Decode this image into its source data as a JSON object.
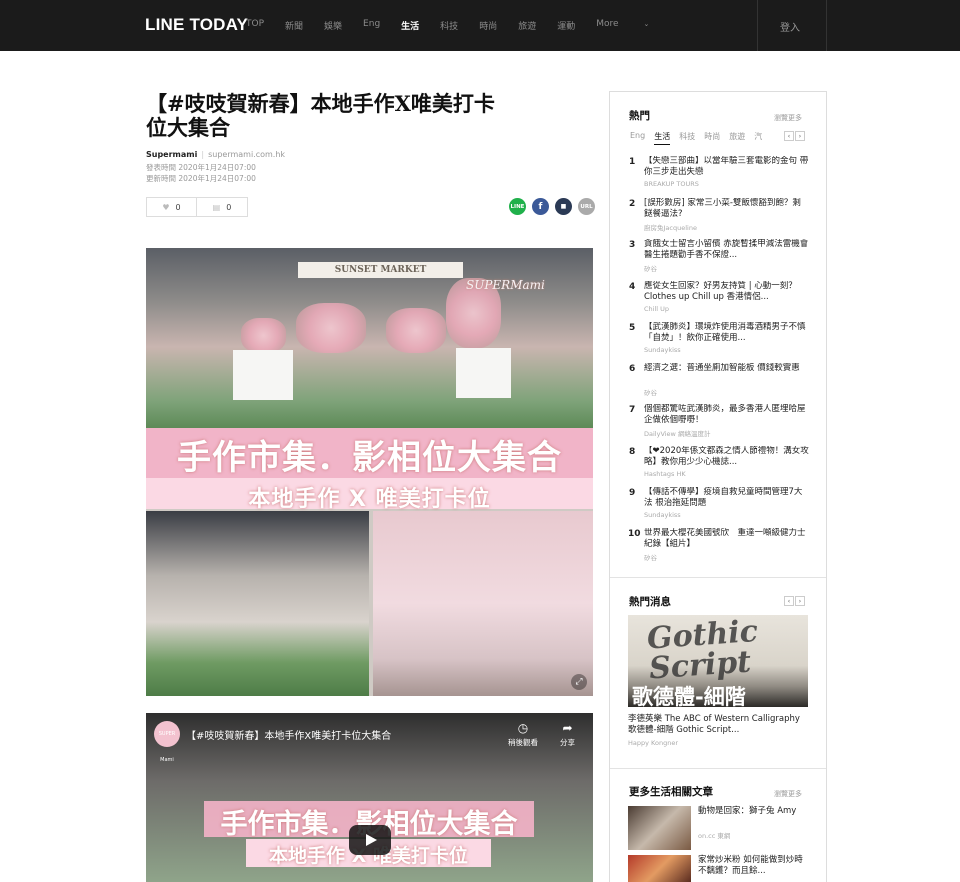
{
  "brand": "LINE TODAY",
  "nav": {
    "items": [
      "TOP",
      "新聞",
      "娛樂",
      "Eng",
      "生活",
      "科技",
      "時尚",
      "旅遊",
      "運動"
    ],
    "active": "生活",
    "more_label": "More",
    "login_label": "登入"
  },
  "article": {
    "title_line1": "【#吱吱賀新春】本地手作X唯美打卡",
    "title_line2": "位大集合",
    "publisher": "Supermami",
    "publisher_url": "supermami.com.hk",
    "published": "發表時間 2020年1月24日07:00",
    "updated": "更新時間 2020年1月24日07:00",
    "likes": "0",
    "comments": "0",
    "share_buttons": [
      "LINE",
      "f",
      "■",
      "URL"
    ],
    "hero": {
      "stall_sign": "SUNSET MARKET",
      "logo_text": "SUPERMami",
      "headline": "手作市集．影相位大集合",
      "subline": "本地手作 X 唯美打卡位"
    },
    "video": {
      "channel_label": "SUPER Mami",
      "title": "【#吱吱賀新春】本地手作X唯美打卡位大集合",
      "watch_later": "稍後觀看",
      "share": "分享",
      "headline": "手作市集．影相位大集合",
      "subline": "本地手作 X 唯美打卡位"
    }
  },
  "sidebar": {
    "hot": {
      "title": "熱門",
      "more": "瀏覽更多",
      "tabs": [
        "Eng",
        "生活",
        "科技",
        "時尚",
        "旅遊",
        "汽"
      ],
      "active_tab": "生活",
      "items": [
        {
          "num": "1",
          "text": "【失戀三部曲】以當年驗三套電影的金句 帶你三步走出失戀",
          "source": "BREAKUP TOURS"
        },
        {
          "num": "2",
          "text": "[誤形數房] 家常三小菜-雙飯懷豁到飽？剩餸餐逼法?",
          "source": "廚房兔Jacqueline"
        },
        {
          "num": "3",
          "text": "貪餓女士留言小留儐 赤旋暫揉甲減法雷機會 醫生捲題勸手香不保證...",
          "source": "矽谷"
        },
        {
          "num": "4",
          "text": "應從女生回家？好男友持質 | 心動一刻？Clothes up Chill up 香港情侶...",
          "source": "Chill Up"
        },
        {
          "num": "5",
          "text": "【武漢肺炎】環境炸使用消毒酒精男子不慎「自焚」！飲你正確使用...",
          "source": "Sundaykiss"
        },
        {
          "num": "6",
          "text": "經濟之選：普通坐廁加智能板 價錢較實惠",
          "source": "矽谷"
        },
        {
          "num": "7",
          "text": "個個都驚咗武漢肺炎，最多香港人匿埋哈屋企做依個嘢嘢！",
          "source": "DailyView 網絡溫度計"
        },
        {
          "num": "8",
          "text": "【❤2020年係文都森之情人節禮物！溝女攻略】教你用少少心機誌...",
          "source": "Hashtags HK"
        },
        {
          "num": "9",
          "text": "【傳話不傳學】疫境自救兒童時間管理7大法 根治拖延問題",
          "source": "Sundaykiss"
        },
        {
          "num": "10",
          "text": "世界最大櫻花美國號欣　重達一噸級健力士紀錄【組片】",
          "source": "矽谷"
        }
      ]
    },
    "news": {
      "title": "熱門消息",
      "image_text_gothic": "Gothic Script",
      "image_text_cn": "歌德體-細階",
      "caption": "李德英樂 The ABC of Western Calligraphy 歌德體-細階 Gothic Script...",
      "source": "Happy Kongner"
    },
    "more": {
      "title": "更多生活相關文章",
      "more": "瀏覽更多",
      "items": [
        {
          "text": "動物是回家：獅子兔 Amy",
          "source": "on.cc 東網"
        },
        {
          "text": "家常炒米粉 如何能做到炒時不黐鑊？而且餘...",
          "source": ""
        }
      ]
    }
  },
  "colors": {
    "topbar": "#1b1b1b",
    "line_green": "#20b04b",
    "facebook": "#3b5998",
    "hero_pink": "#f4b2c8"
  }
}
